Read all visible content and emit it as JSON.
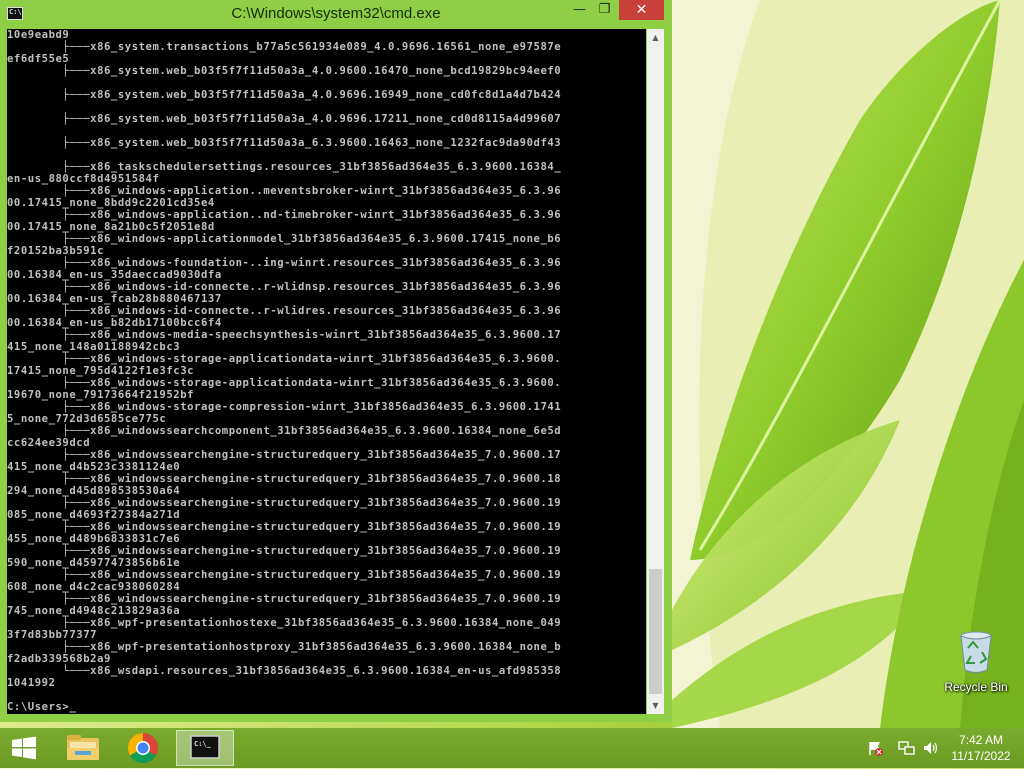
{
  "window": {
    "title": "C:\\Windows\\system32\\cmd.exe",
    "icon_label": "C:\\",
    "minimize": "—",
    "maximize": "❐",
    "close": "✕"
  },
  "console": {
    "lines": [
      "10e9eabd9",
      "        ├───x86_system.transactions_b77a5c561934e089_4.0.9696.16561_none_e97587e",
      "ef6df55e5",
      "        ├───x86_system.web_b03f5f7f11d50a3a_4.0.9600.16470_none_bcd19829bc94eef0",
      "",
      "        ├───x86_system.web_b03f5f7f11d50a3a_4.0.9696.16949_none_cd0fc8d1a4d7b424",
      "",
      "        ├───x86_system.web_b03f5f7f11d50a3a_4.0.9696.17211_none_cd0d8115a4d99607",
      "",
      "        ├───x86_system.web_b03f5f7f11d50a3a_6.3.9600.16463_none_1232fac9da90df43",
      "",
      "        ├───x86_taskschedulersettings.resources_31bf3856ad364e35_6.3.9600.16384_",
      "en-us_880ccf8d4951584f",
      "        ├───x86_windows-application..meventsbroker-winrt_31bf3856ad364e35_6.3.96",
      "00.17415_none_8bdd9c2201cd35e4",
      "        ├───x86_windows-application..nd-timebroker-winrt_31bf3856ad364e35_6.3.96",
      "00.17415_none_8a21b0c5f2051e8d",
      "        ├───x86_windows-applicationmodel_31bf3856ad364e35_6.3.9600.17415_none_b6",
      "f20152ba3b591c",
      "        ├───x86_windows-foundation-..ing-winrt.resources_31bf3856ad364e35_6.3.96",
      "00.16384_en-us_35daeccad9030dfa",
      "        ├───x86_windows-id-connecte..r-wlidnsp.resources_31bf3856ad364e35_6.3.96",
      "00.16384_en-us_fcab28b880467137",
      "        ├───x86_windows-id-connecte..r-wlidres.resources_31bf3856ad364e35_6.3.96",
      "00.16384_en-us_b82db17100bcc6f4",
      "        ├───x86_windows-media-speechsynthesis-winrt_31bf3856ad364e35_6.3.9600.17",
      "415_none_148a01188942cbc3",
      "        ├───x86_windows-storage-applicationdata-winrt_31bf3856ad364e35_6.3.9600.",
      "17415_none_795d4122f1e3fc3c",
      "        ├───x86_windows-storage-applicationdata-winrt_31bf3856ad364e35_6.3.9600.",
      "19670_none_79173664f21952bf",
      "        ├───x86_windows-storage-compression-winrt_31bf3856ad364e35_6.3.9600.1741",
      "5_none_772d3d6585ce775c",
      "        ├───x86_windowssearchcomponent_31bf3856ad364e35_6.3.9600.16384_none_6e5d",
      "cc624ee39dcd",
      "        ├───x86_windowssearchengine-structuredquery_31bf3856ad364e35_7.0.9600.17",
      "415_none_d4b523c3381124e0",
      "        ├───x86_windowssearchengine-structuredquery_31bf3856ad364e35_7.0.9600.18",
      "294_none_d45d898538530a64",
      "        ├───x86_windowssearchengine-structuredquery_31bf3856ad364e35_7.0.9600.19",
      "085_none_d4693f27384a271d",
      "        ├───x86_windowssearchengine-structuredquery_31bf3856ad364e35_7.0.9600.19",
      "455_none_d489b6833831c7e6",
      "        ├───x86_windowssearchengine-structuredquery_31bf3856ad364e35_7.0.9600.19",
      "590_none_d45977473856b61e",
      "        ├───x86_windowssearchengine-structuredquery_31bf3856ad364e35_7.0.9600.19",
      "608_none_d4c2cac938060284",
      "        ├───x86_windowssearchengine-structuredquery_31bf3856ad364e35_7.0.9600.19",
      "745_none_d4948c213829a36a",
      "        ├───x86_wpf-presentationhostexe_31bf3856ad364e35_6.3.9600.16384_none_049",
      "3f7d83bb77377",
      "        ├───x86_wpf-presentationhostproxy_31bf3856ad364e35_6.3.9600.16384_none_b",
      "f2adb339568b2a9",
      "        └───x86_wsdapi.resources_31bf3856ad364e35_6.3.9600.16384_en-us_afd985358",
      "1041992",
      "",
      "C:\\Users>_"
    ]
  },
  "desktop": {
    "recycle_bin_label": "Recycle Bin"
  },
  "taskbar": {
    "apps": [
      "File Explorer",
      "Google Chrome",
      "Command Prompt"
    ],
    "cmd_icon_text": "C:\\_",
    "clock_time": "7:42 AM",
    "clock_date": "11/17/2022"
  },
  "colors": {
    "window_frame": "#8ecf45",
    "close_button": "#c7413a",
    "console_bg": "#000000",
    "console_text": "#c0c0c0",
    "taskbar": "#6c9a22"
  }
}
